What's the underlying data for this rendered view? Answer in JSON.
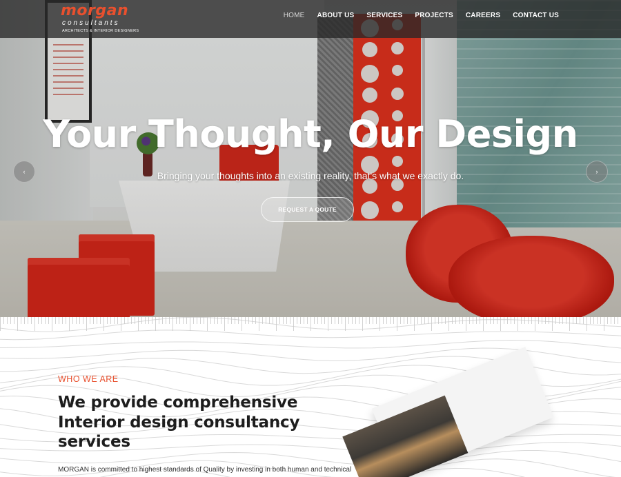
{
  "brand": {
    "name": "morgan",
    "subtitle": "consultants",
    "tagline": "ARCHITECTS & INTERIOR DESIGNERS",
    "accent_color": "#e8502e"
  },
  "nav": {
    "items": [
      {
        "label": "HOME",
        "active": true
      },
      {
        "label": "ABOUT US",
        "active": false
      },
      {
        "label": "SERVICES",
        "active": false
      },
      {
        "label": "PROJECTS",
        "active": false
      },
      {
        "label": "CAREERS",
        "active": false
      },
      {
        "label": "CONTACT US",
        "active": false
      }
    ]
  },
  "hero": {
    "headline": "Your Thought, Our Design",
    "subheadline": "Bringing your thoughts into an existing reality, that's what we exactly do.",
    "cta_label": "REQUEST A QOUTE",
    "prev_arrow": "‹",
    "next_arrow": "›",
    "prev_icon": "chevron-left-icon",
    "next_icon": "chevron-right-icon"
  },
  "about": {
    "eyebrow": "WHO WE ARE",
    "title": "We provide comprehensive Interior design consultancy services",
    "body": "MORGAN is committed to highest standards of Quality by investing in both human and technical"
  }
}
